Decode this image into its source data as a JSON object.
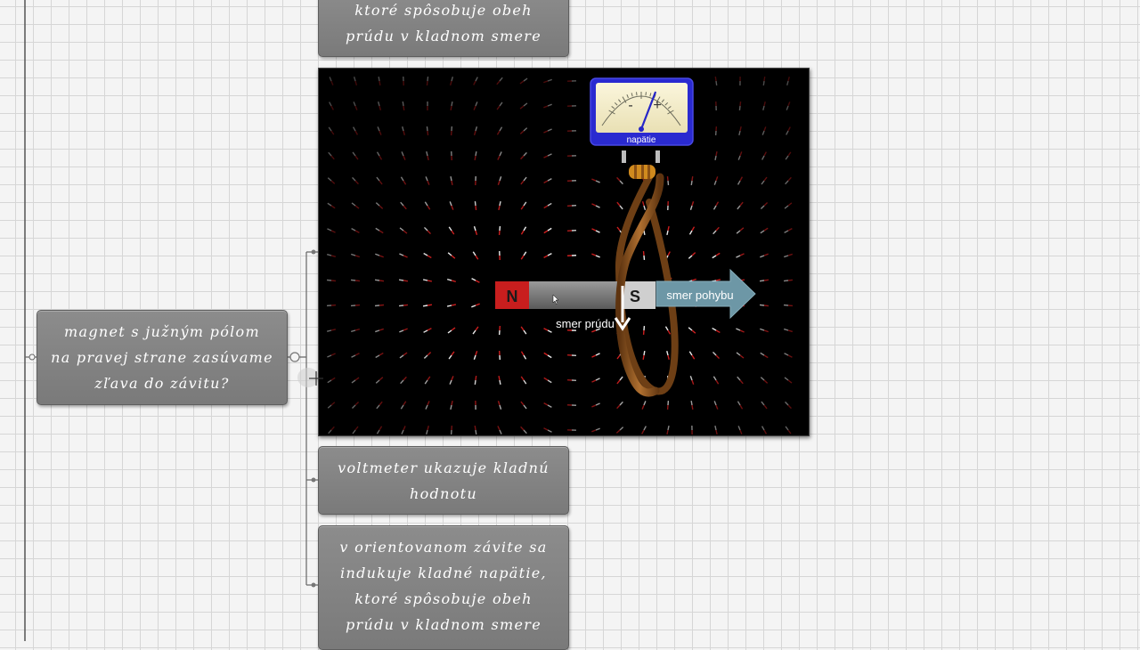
{
  "nodes": {
    "top": {
      "lines": [
        "ktoré spôsobuje obeh",
        "prúdu v kladnom smere"
      ]
    },
    "question": {
      "lines": [
        "magnet s južným pólom",
        "na pravej strane zasúvame",
        "zľava do závitu?"
      ]
    },
    "voltmeter_note": {
      "lines": [
        "voltmeter ukazuje kladnú",
        "hodnotu"
      ]
    },
    "induction_note": {
      "lines": [
        "v orientovanom závite sa",
        "indukuje kladné napätie,",
        "ktoré spôsobuje obeh",
        "prúdu v kladnom smere"
      ]
    }
  },
  "simulation": {
    "meter": {
      "minus": "-",
      "plus": "+",
      "label": "napätie",
      "reading": 0.35
    },
    "magnet": {
      "north": "N",
      "south": "S"
    },
    "motion_label": "smer pohybu",
    "current_label": "smer prúdu"
  },
  "colors": {
    "node_bg": "#848484",
    "sim_bg": "#000000",
    "north_pole": "#c81e1e",
    "south_pole": "#c8c8c8",
    "coil": "#8a5220",
    "motion_arrow": "#6d97a6",
    "meter_frame": "#2a2ad0"
  }
}
